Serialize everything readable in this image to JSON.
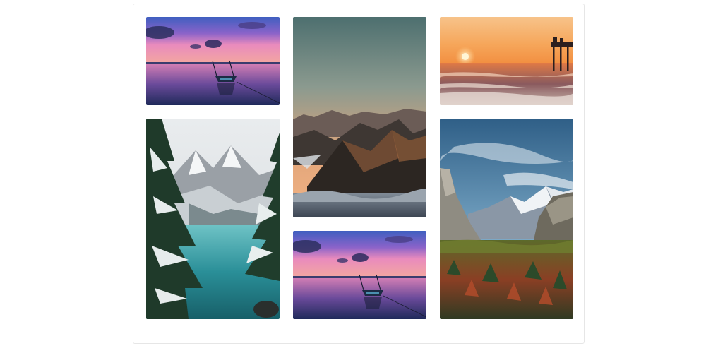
{
  "gallery": {
    "images": [
      {
        "subject": "boat-lake-sunset"
      },
      {
        "subject": "mountain-peaks-dusk"
      },
      {
        "subject": "beach-pier-sunset"
      },
      {
        "subject": "snowy-lake-forest"
      },
      {
        "subject": "yosemite-valley"
      },
      {
        "subject": "boat-lake-sunset"
      }
    ]
  },
  "colors": {
    "card_border": "#e6e6e6",
    "page_background": "#ffffff"
  }
}
